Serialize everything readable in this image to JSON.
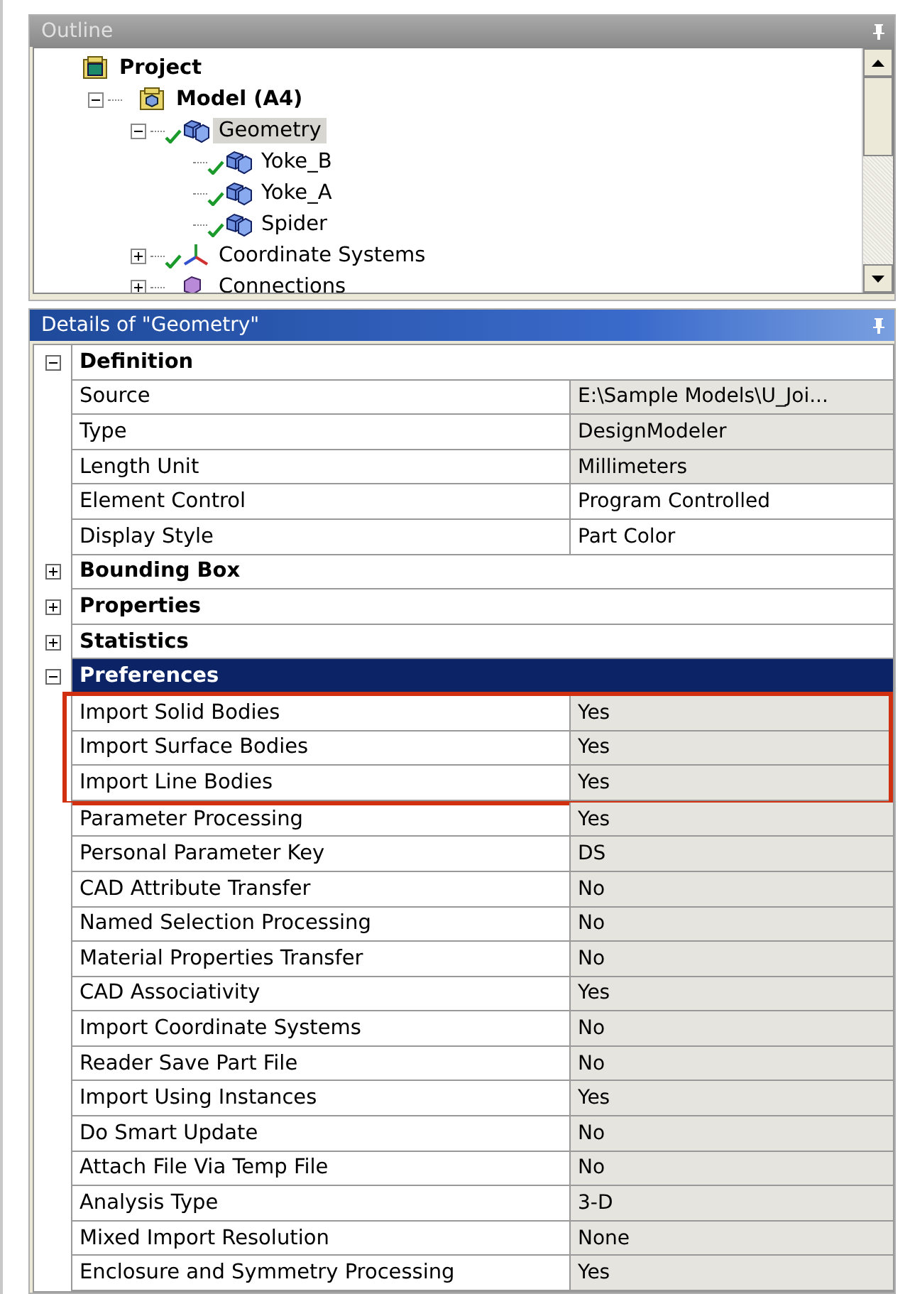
{
  "outline": {
    "title": "Outline",
    "tree": [
      {
        "label": "Project",
        "kind": "project",
        "bold": true,
        "checked": false,
        "selected": false,
        "children": [
          {
            "label": "Model (A4)",
            "kind": "model",
            "bold": true,
            "checked": false,
            "selected": false,
            "expanded": true,
            "children": [
              {
                "label": "Geometry",
                "kind": "body",
                "bold": false,
                "checked": true,
                "selected": true,
                "expanded": true,
                "children": [
                  {
                    "label": "Yoke_B",
                    "kind": "body",
                    "bold": false,
                    "checked": true,
                    "selected": false
                  },
                  {
                    "label": "Yoke_A",
                    "kind": "body",
                    "bold": false,
                    "checked": true,
                    "selected": false
                  },
                  {
                    "label": "Spider",
                    "kind": "body",
                    "bold": false,
                    "checked": true,
                    "selected": false
                  }
                ]
              },
              {
                "label": "Coordinate Systems",
                "kind": "axes",
                "bold": false,
                "checked": true,
                "selected": false,
                "expanded": false
              },
              {
                "label": "Connections",
                "kind": "connections",
                "bold": false,
                "checked": false,
                "selected": false,
                "expanded": false
              }
            ]
          }
        ]
      }
    ]
  },
  "details": {
    "title": "Details of \"Geometry\"",
    "groups": [
      {
        "label": "Definition",
        "expanded": true,
        "selected": false,
        "rows": [
          {
            "name": "Source",
            "value": "E:\\Sample Models\\U_Joi...",
            "readonly": true,
            "highlighted": false
          },
          {
            "name": "Type",
            "value": "DesignModeler",
            "readonly": true,
            "highlighted": false
          },
          {
            "name": "Length Unit",
            "value": "Millimeters",
            "readonly": true,
            "highlighted": false
          },
          {
            "name": "Element Control",
            "value": "Program Controlled",
            "readonly": false,
            "highlighted": false
          },
          {
            "name": "Display Style",
            "value": "Part Color",
            "readonly": false,
            "highlighted": false
          }
        ]
      },
      {
        "label": "Bounding Box",
        "expanded": false,
        "selected": false
      },
      {
        "label": "Properties",
        "expanded": false,
        "selected": false
      },
      {
        "label": "Statistics",
        "expanded": false,
        "selected": false
      },
      {
        "label": "Preferences",
        "expanded": true,
        "selected": true,
        "rows": [
          {
            "name": "Import Solid Bodies",
            "value": "Yes",
            "readonly": true,
            "highlighted": true
          },
          {
            "name": "Import Surface Bodies",
            "value": "Yes",
            "readonly": true,
            "highlighted": true
          },
          {
            "name": "Import Line Bodies",
            "value": "Yes",
            "readonly": true,
            "highlighted": true
          },
          {
            "name": "Parameter Processing",
            "value": "Yes",
            "readonly": true,
            "highlighted": false
          },
          {
            "name": "Personal Parameter Key",
            "value": "DS",
            "readonly": true,
            "highlighted": false
          },
          {
            "name": "CAD Attribute Transfer",
            "value": "No",
            "readonly": true,
            "highlighted": false
          },
          {
            "name": "Named Selection Processing",
            "value": "No",
            "readonly": true,
            "highlighted": false
          },
          {
            "name": "Material Properties Transfer",
            "value": "No",
            "readonly": true,
            "highlighted": false
          },
          {
            "name": "CAD Associativity",
            "value": "Yes",
            "readonly": true,
            "highlighted": false
          },
          {
            "name": "Import Coordinate Systems",
            "value": "No",
            "readonly": true,
            "highlighted": false
          },
          {
            "name": "Reader Save Part File",
            "value": "No",
            "readonly": true,
            "highlighted": false
          },
          {
            "name": "Import Using Instances",
            "value": "Yes",
            "readonly": true,
            "highlighted": false
          },
          {
            "name": "Do Smart Update",
            "value": "No",
            "readonly": true,
            "highlighted": false
          },
          {
            "name": "Attach File Via Temp File",
            "value": "No",
            "readonly": true,
            "highlighted": false
          },
          {
            "name": "Analysis Type",
            "value": "3-D",
            "readonly": true,
            "highlighted": false
          },
          {
            "name": "Mixed Import Resolution",
            "value": "None",
            "readonly": true,
            "highlighted": false
          },
          {
            "name": "Enclosure and Symmetry Processing",
            "value": "Yes",
            "readonly": true,
            "highlighted": false
          }
        ]
      }
    ]
  }
}
